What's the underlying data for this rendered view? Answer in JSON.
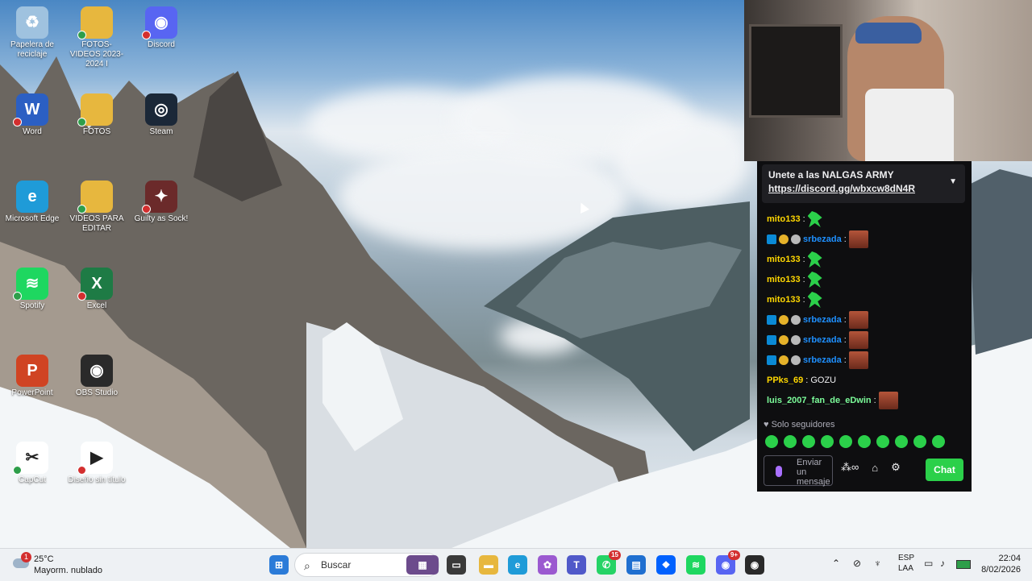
{
  "desktop": {
    "icons": [
      {
        "label": "Papelera de reciclaje",
        "icon": "recycle-bin-icon",
        "color": "#9fc2df",
        "glyph": "♻",
        "status": "none"
      },
      {
        "label": "FOTOS- VIDEOS 2023-2024 I",
        "icon": "folder-icon",
        "color": "#e7b73e",
        "glyph": "",
        "status": "ok"
      },
      {
        "label": "Discord",
        "icon": "discord-icon",
        "color": "#5865f2",
        "glyph": "◉",
        "status": "err"
      },
      {
        "label": "Word",
        "icon": "word-icon",
        "color": "#2b5fc3",
        "glyph": "W",
        "status": "err"
      },
      {
        "label": "FOTOS",
        "icon": "folder-icon",
        "color": "#e7b73e",
        "glyph": "",
        "status": "ok"
      },
      {
        "label": "Steam",
        "icon": "steam-icon",
        "color": "#1b2838",
        "glyph": "◎",
        "status": "none"
      },
      {
        "label": "Microsoft Edge",
        "icon": "edge-icon",
        "color": "#1f9bd8",
        "glyph": "e",
        "status": "none"
      },
      {
        "label": "VIDEOS PARA EDITAR",
        "icon": "folder-icon",
        "color": "#e7b73e",
        "glyph": "",
        "status": "ok"
      },
      {
        "label": "Guilty as Sock!",
        "icon": "game-icon",
        "color": "#6b2a2a",
        "glyph": "✦",
        "status": "err"
      },
      {
        "label": "Spotify",
        "icon": "spotify-icon",
        "color": "#1ed760",
        "glyph": "≋",
        "status": "ok"
      },
      {
        "label": "Excel",
        "icon": "excel-icon",
        "color": "#1e7b45",
        "glyph": "X",
        "status": "err"
      },
      {
        "label": "PowerPoint",
        "icon": "powerpoint-icon",
        "color": "#d04423",
        "glyph": "P",
        "status": "none"
      },
      {
        "label": "OBS Studio",
        "icon": "obs-icon",
        "color": "#2a2a2a",
        "glyph": "◉",
        "status": "none"
      },
      {
        "label": "CapCut",
        "icon": "capcut-icon",
        "color": "#ffffff",
        "glyph": "✂",
        "status": "ok"
      },
      {
        "label": "Diseño sin título",
        "icon": "video-file-icon",
        "color": "#ffffff",
        "glyph": "▶",
        "status": "err"
      }
    ]
  },
  "chat": {
    "pinned_title": "Unete a las NALGAS ARMY",
    "pinned_link": "https://discord.gg/wbxcw8dN4R",
    "messages": [
      {
        "user": "mito133",
        "color": "#ffd700",
        "badges": [],
        "emote": "green",
        "text": ""
      },
      {
        "user": "srbezada",
        "color": "#1e90ff",
        "badges": [
          "mod",
          "sub",
          "bomb"
        ],
        "emote": "face",
        "text": ""
      },
      {
        "user": "mito133",
        "color": "#ffd700",
        "badges": [],
        "emote": "green",
        "text": ""
      },
      {
        "user": "mito133",
        "color": "#ffd700",
        "badges": [],
        "emote": "green",
        "text": ""
      },
      {
        "user": "mito133",
        "color": "#ffd700",
        "badges": [],
        "emote": "green",
        "text": ""
      },
      {
        "user": "srbezada",
        "color": "#1e90ff",
        "badges": [
          "mod",
          "sub",
          "bomb"
        ],
        "emote": "face",
        "text": ""
      },
      {
        "user": "srbezada",
        "color": "#1e90ff",
        "badges": [
          "mod",
          "sub",
          "bomb"
        ],
        "emote": "face",
        "text": ""
      },
      {
        "user": "srbezada",
        "color": "#1e90ff",
        "badges": [
          "mod",
          "sub",
          "bomb"
        ],
        "emote": "face",
        "text": ""
      },
      {
        "user": "PPks_69",
        "color": "#ffd700",
        "badges": [],
        "emote": "",
        "text": "GOZU"
      },
      {
        "user": "luis_2007_fan_de_eDwin",
        "color": "#7cfc9a",
        "badges": [],
        "emote": "face",
        "text": ""
      }
    ],
    "followers_only": "Solo seguidores",
    "input_placeholder": "Enviar un mensaje",
    "send_label": "Chat",
    "accent": "#2bd04a"
  },
  "taskbar": {
    "weather_temp": "25°C",
    "weather_desc": "Mayorm. nublado",
    "weather_badge": "1",
    "search_placeholder": "Buscar",
    "apps": [
      {
        "icon": "windows-start-icon",
        "color": "#2b7bd8",
        "glyph": "⊞"
      },
      {
        "icon": "search-icon",
        "color": "",
        "glyph": ""
      },
      {
        "icon": "widgets-icon",
        "color": "#6c4b8c",
        "glyph": "▦"
      },
      {
        "icon": "task-view-icon",
        "color": "#3a3a3a",
        "glyph": "▭"
      },
      {
        "icon": "file-explorer-icon",
        "color": "#e7b73e",
        "glyph": "▬"
      },
      {
        "icon": "edge-icon",
        "color": "#1f9bd8",
        "glyph": "e"
      },
      {
        "icon": "copilot-icon",
        "color": "#9b59d0",
        "glyph": "✿"
      },
      {
        "icon": "teams-icon",
        "color": "#5059c9",
        "glyph": "T"
      },
      {
        "icon": "whatsapp-icon",
        "color": "#25d366",
        "glyph": "✆",
        "badge": "15"
      },
      {
        "icon": "store-icon",
        "color": "#1f6fd0",
        "glyph": "▤"
      },
      {
        "icon": "dropbox-icon",
        "color": "#0061fe",
        "glyph": "❖"
      },
      {
        "icon": "spotify-icon",
        "color": "#1ed760",
        "glyph": "≋"
      },
      {
        "icon": "discord-icon",
        "color": "#5865f2",
        "glyph": "◉",
        "badge": "9+"
      },
      {
        "icon": "obs-icon",
        "color": "#2a2a2a",
        "glyph": "◉"
      }
    ],
    "lang_line1": "ESP",
    "lang_line2": "LAA",
    "time": "22:04",
    "date": "8/02/2026"
  }
}
